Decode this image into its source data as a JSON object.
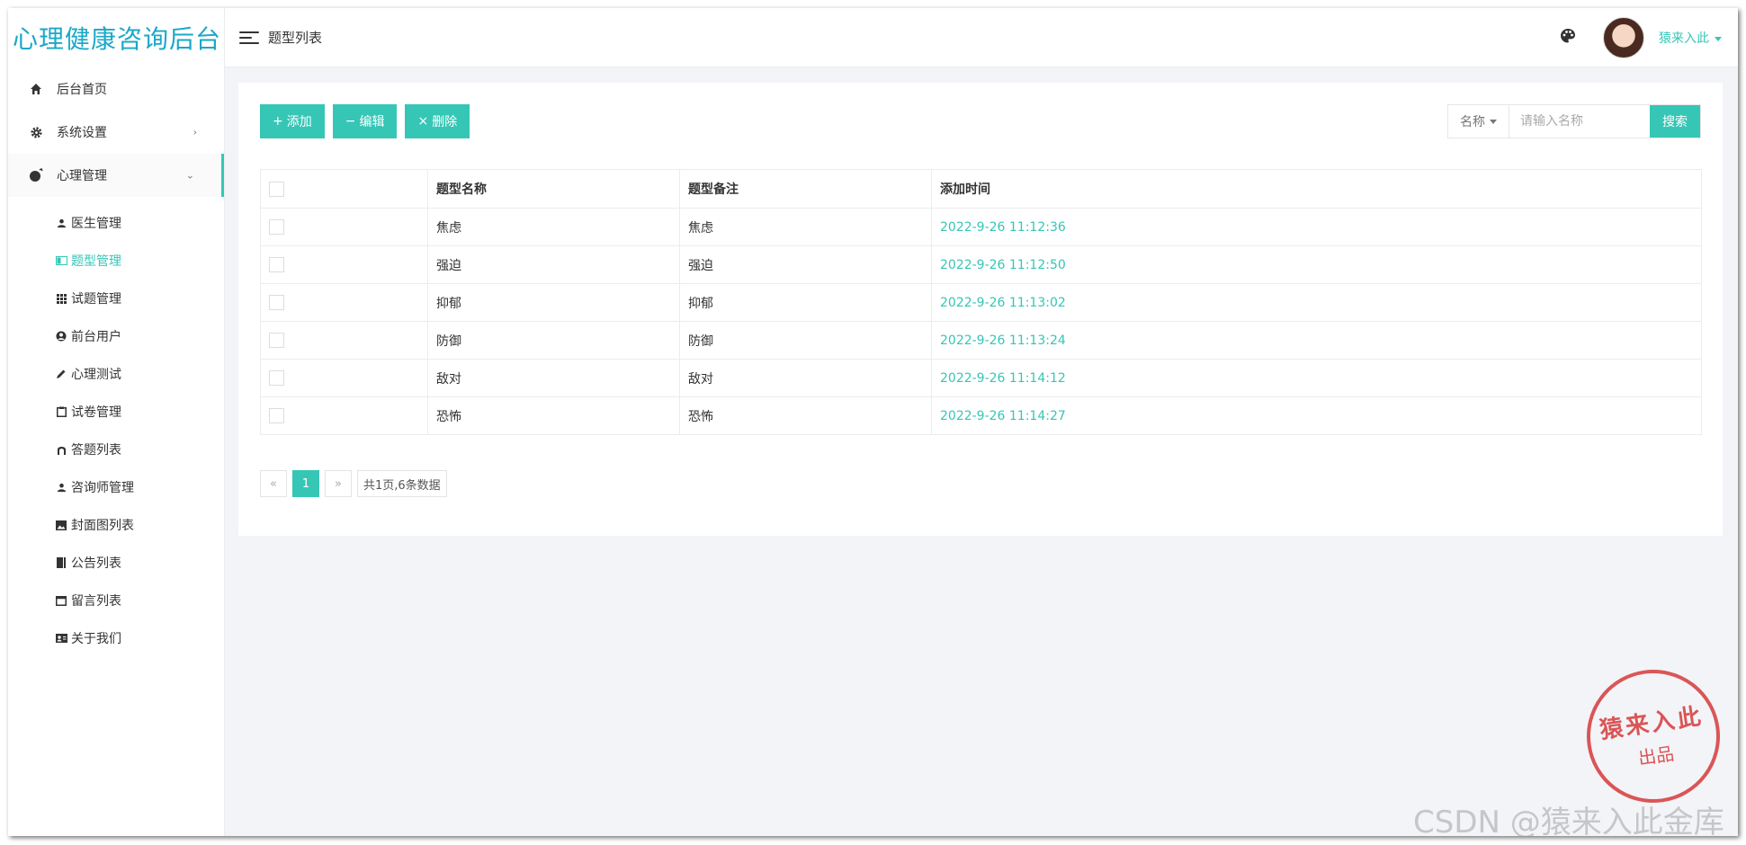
{
  "app": {
    "title": "心理健康咨询后台"
  },
  "header": {
    "page_title": "题型列表",
    "user_name": "猿来入此"
  },
  "sidebar": {
    "items": [
      {
        "label": "后台首页",
        "icon": "home-icon"
      },
      {
        "label": "系统设置",
        "icon": "gear-icon"
      },
      {
        "label": "心理管理",
        "icon": "mind-icon"
      }
    ],
    "sub_items": [
      {
        "label": "医生管理",
        "icon": "user-icon"
      },
      {
        "label": "题型管理",
        "icon": "card-icon"
      },
      {
        "label": "试题管理",
        "icon": "grid-icon"
      },
      {
        "label": "前台用户",
        "icon": "user-circle-icon"
      },
      {
        "label": "心理测试",
        "icon": "pencil-icon"
      },
      {
        "label": "试卷管理",
        "icon": "clipboard-icon"
      },
      {
        "label": "答题列表",
        "icon": "arch-icon"
      },
      {
        "label": "咨询师管理",
        "icon": "user-icon"
      },
      {
        "label": "封面图列表",
        "icon": "image-icon"
      },
      {
        "label": "公告列表",
        "icon": "book-icon"
      },
      {
        "label": "留言列表",
        "icon": "window-icon"
      },
      {
        "label": "关于我们",
        "icon": "id-card-icon"
      }
    ]
  },
  "toolbar": {
    "add_label": "添加",
    "edit_label": "编辑",
    "delete_label": "删除"
  },
  "search": {
    "field_label": "名称",
    "placeholder": "请输入名称",
    "button_label": "搜索"
  },
  "table": {
    "headers": [
      "题型名称",
      "题型备注",
      "添加时间"
    ],
    "rows": [
      {
        "name": "焦虑",
        "note": "焦虑",
        "time": "2022-9-26 11:12:36"
      },
      {
        "name": "强迫",
        "note": "强迫",
        "time": "2022-9-26 11:12:50"
      },
      {
        "name": "抑郁",
        "note": "抑郁",
        "time": "2022-9-26 11:13:02"
      },
      {
        "name": "防御",
        "note": "防御",
        "time": "2022-9-26 11:13:24"
      },
      {
        "name": "敌对",
        "note": "敌对",
        "time": "2022-9-26 11:14:12"
      },
      {
        "name": "恐怖",
        "note": "恐怖",
        "time": "2022-9-26 11:14:27"
      }
    ]
  },
  "pager": {
    "prev": "«",
    "current": "1",
    "next": "»",
    "info": "共1页,6条数据"
  },
  "stamp": {
    "line1": "猿来入此",
    "line2": "出品"
  },
  "watermark": "CSDN @猿来入此金库",
  "colors": {
    "accent": "#36c6b6",
    "brand": "#1aa8c8",
    "stamp": "#d63a3a"
  }
}
